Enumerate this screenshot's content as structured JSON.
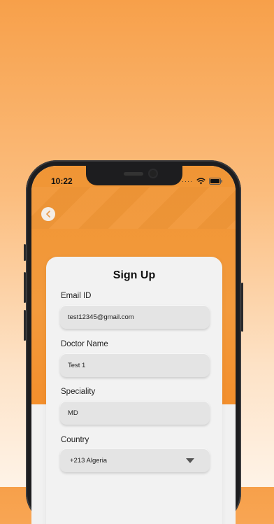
{
  "status_bar": {
    "time": "10:22",
    "signal_dots": "····"
  },
  "form": {
    "title": "Sign Up",
    "fields": [
      {
        "label": "Email ID",
        "value": "test12345@gmail.com"
      },
      {
        "label": "Doctor Name",
        "value": "Test 1"
      },
      {
        "label": "Speciality",
        "value": "MD"
      },
      {
        "label": "Country",
        "value": "+213 Algeria"
      }
    ]
  },
  "colors": {
    "accent": "#f39a3c",
    "card": "#f2f2f2",
    "field": "#e4e4e4"
  },
  "icons": [
    "back-arrow-icon",
    "wifi-icon",
    "battery-icon",
    "dropdown-caret-icon"
  ]
}
